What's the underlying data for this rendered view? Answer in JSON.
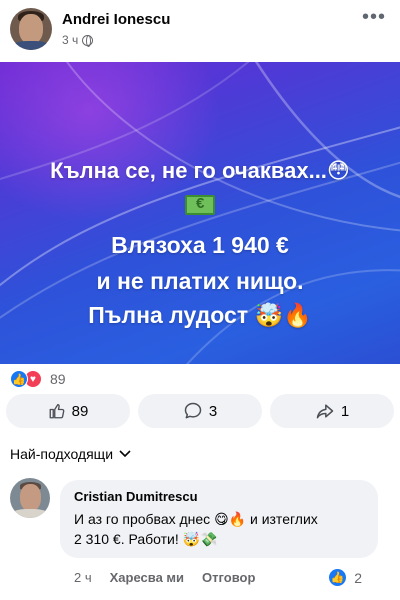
{
  "post": {
    "author": "Andrei Ionescu",
    "time": "3 ч",
    "more_label": "•••",
    "banner": {
      "line1": "Кълна се, не го очаквах...😳",
      "line2": "Влязоха 1 940 €",
      "line3": "и не платих нищо.",
      "line4": "Пълна лудост 🤯🔥"
    },
    "reactions_count": "89",
    "actions": {
      "like_count": "89",
      "comment_count": "3",
      "share_count": "1"
    }
  },
  "comments": {
    "sort_label": "Най-подходящи",
    "items": [
      {
        "author": "Cristian Dumitrescu",
        "text_line1": "И аз го пробвах днес 😋🔥 и изтеглих",
        "text_line2": "2 310 €. Работи! 🤯💸",
        "time": "2 ч",
        "like_label": "Харесва ми",
        "reply_label": "Отговор",
        "reaction_count": "2"
      }
    ]
  },
  "icons": {
    "globe": "globe-icon",
    "like": "thumbs-up-icon",
    "love": "heart-icon",
    "comment": "comment-bubble-icon",
    "share": "share-arrow-icon",
    "chevron": "chevron-down-icon",
    "money": "money-bill-icon"
  },
  "colors": {
    "accent": "#1877f2",
    "love": "#f33e58",
    "button_bg": "#f0f2f5",
    "muted_text": "#65676b"
  }
}
